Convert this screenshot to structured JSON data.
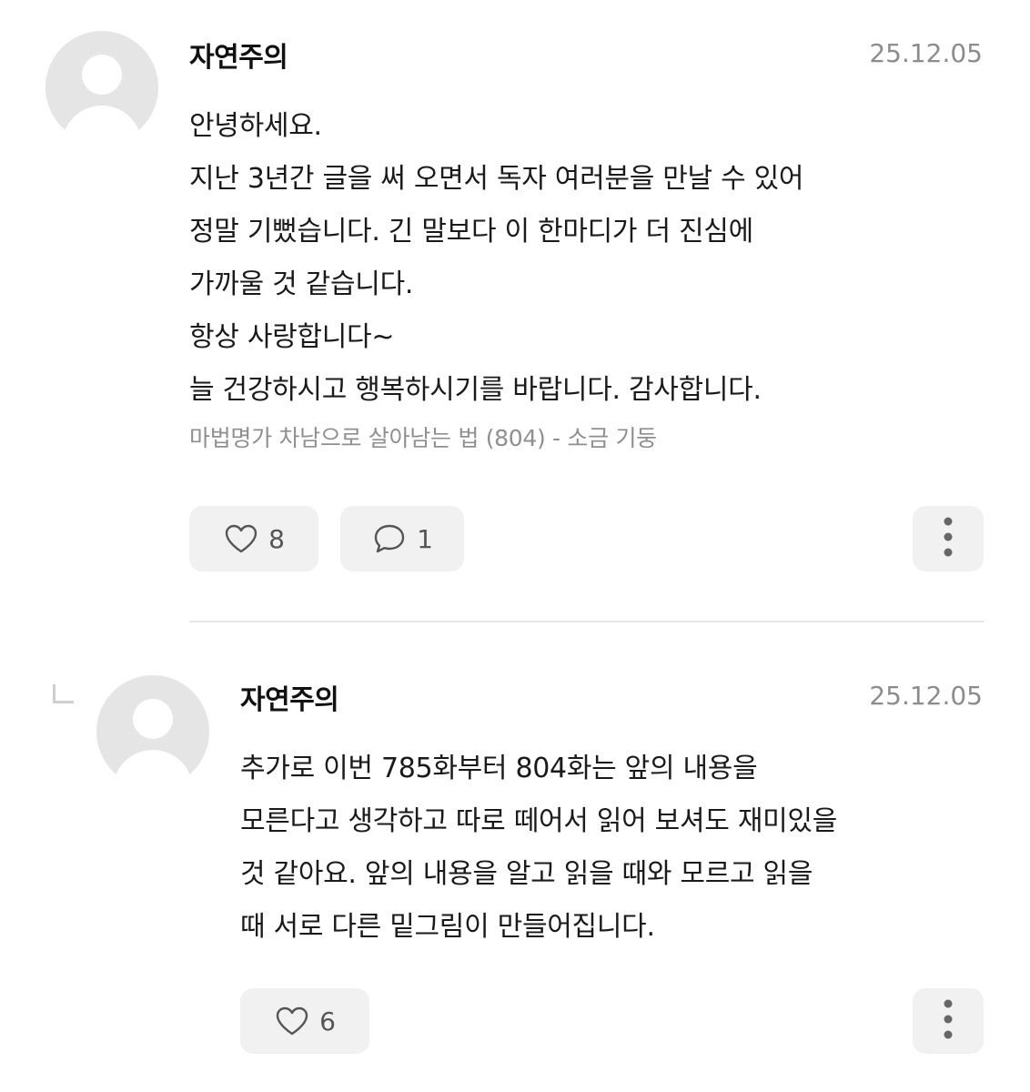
{
  "comments": [
    {
      "username": "자연주의",
      "date": "25.12.05",
      "lines": [
        "안녕하세요.",
        "지난 3년간 글을 써 오면서 독자 여러분을 만날 수 있어",
        "정말 기뻤습니다. 긴 말보다 이 한마디가 더 진심에",
        "가까울 것 같습니다.",
        "항상 사랑합니다~",
        "늘 건강하시고 행복하시기를 바랍니다. 감사합니다."
      ],
      "source": "마법명가 차남으로 살아남는 법 (804) - 소금 기둥",
      "likes": "8",
      "replies": "1",
      "icons": {
        "like": "heart-icon",
        "reply": "comment-icon",
        "more": "more-vertical-icon",
        "avatar": "default-avatar-icon"
      }
    },
    {
      "username": "자연주의",
      "date": "25.12.05",
      "lines": [
        "추가로 이번 785화부터 804화는 앞의 내용을",
        "모른다고 생각하고 따로 떼어서 읽어 보셔도 재미있을",
        "것 같아요. 앞의 내용을 알고 읽을 때와 모르고 읽을",
        "때 서로 다른 밑그림이 만들어집니다."
      ],
      "likes": "6",
      "icons": {
        "like": "heart-icon",
        "more": "more-vertical-icon",
        "avatar": "default-avatar-icon",
        "reply_indicator": "reply-arrow-icon"
      }
    }
  ],
  "colors": {
    "avatar_bg": "#e5e5e5",
    "pill_bg": "#f1f1f1",
    "meta_text": "#8c8c8c",
    "divider": "#e6e6e6"
  }
}
